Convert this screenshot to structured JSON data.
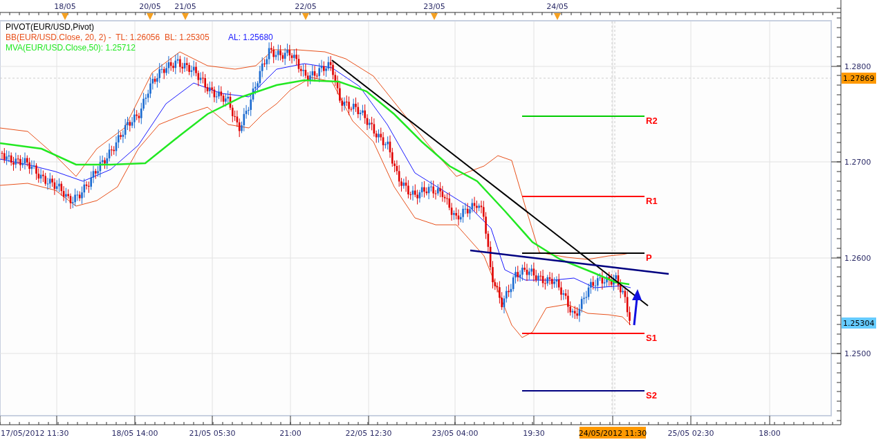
{
  "indicators": [
    {
      "label": "PIVOT(EUR/USD,Pivot)",
      "color": "#000000"
    },
    {
      "label": "BB(EUR/USD.Close, 20, 2) -  TL: 1.26056  BL: 1.25305",
      "color": "#e8501a",
      "extra": {
        "label": "AL: 1.25680",
        "color": "#1a1aff"
      }
    },
    {
      "label": "MVA(EUR/USD.Close,50): 1.25712",
      "color": "#22e822"
    }
  ],
  "date_axis": {
    "labels": [
      "18/05",
      "20/05",
      "21/05",
      "22/05",
      "23/05",
      "24/05"
    ]
  },
  "price_axis": {
    "labels": [
      "1.2800",
      "1.2700",
      "1.2600",
      "1.2500"
    ],
    "tags": [
      {
        "text": "1.27869",
        "color": "#ff9900"
      },
      {
        "text": "1.25304",
        "color": "#66ccff"
      }
    ]
  },
  "pivots": [
    {
      "label": "R2",
      "color": "#00cc00"
    },
    {
      "label": "R1",
      "color": "#ff0000"
    },
    {
      "label": "P",
      "color": "#000000"
    },
    {
      "label": "S1",
      "color": "#ff0000"
    },
    {
      "label": "S2",
      "color": "#000080"
    }
  ],
  "time_axis": {
    "labels": [
      {
        "text": "17/05/2012 11:30",
        "highlighted": false
      },
      {
        "text": "18/05 14:00",
        "highlighted": false
      },
      {
        "text": "21/05 05:30",
        "highlighted": false
      },
      {
        "text": "21:00",
        "highlighted": false
      },
      {
        "text": "22/05 12:30",
        "highlighted": false
      },
      {
        "text": "23/05 04:00",
        "highlighted": false
      },
      {
        "text": "19:30",
        "highlighted": false
      },
      {
        "text": "24/05/2012 11:30",
        "highlighted": true
      },
      {
        "text": "25/05 02:30",
        "highlighted": false
      },
      {
        "text": "18:00",
        "highlighted": false
      }
    ]
  }
}
